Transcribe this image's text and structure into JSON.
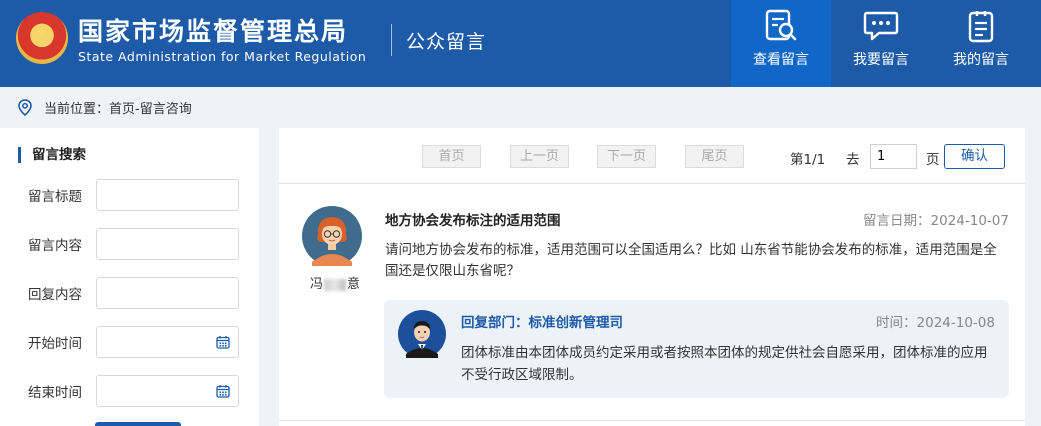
{
  "header": {
    "title_cn": "国家市场监督管理总局",
    "title_en": "State Administration for Market Regulation",
    "subtitle": "公众留言",
    "nav": [
      {
        "label": "查看留言",
        "icon": "search-document-icon",
        "active": true
      },
      {
        "label": "我要留言",
        "icon": "chat-bubble-icon",
        "active": false
      },
      {
        "label": "我的留言",
        "icon": "clipboard-list-icon",
        "active": false
      }
    ]
  },
  "breadcrumb": {
    "label": "当前位置：",
    "path": "首页-留言咨询"
  },
  "search": {
    "title": "留言搜索",
    "fields": [
      {
        "label": "留言标题",
        "value": ""
      },
      {
        "label": "留言内容",
        "value": ""
      },
      {
        "label": "回复内容",
        "value": ""
      },
      {
        "label": "开始时间",
        "value": ""
      },
      {
        "label": "结束时间",
        "value": ""
      }
    ]
  },
  "pager": {
    "first": "首页",
    "prev": "上一页",
    "next": "下一页",
    "last": "尾页",
    "page_info": "第1/1",
    "go_label": "去",
    "page_value": "1",
    "page_unit": "页",
    "confirm": "确认"
  },
  "message": {
    "title": "地方协会发布标注的适用范围",
    "date": "留言日期：2024-10-07",
    "name_prefix": "冯",
    "name_suffix": "意",
    "body": "请问地方协会发布的标准，适用范围可以全国适用么？比如 山东省节能协会发布的标准，适用范围是全国还是仅限山东省呢？",
    "reply": {
      "dept": "回复部门：标准创新管理司",
      "date": "时间：2024-10-08",
      "body": "团体标准由本团体成员约定采用或者按照本团体的规定供社会自愿采用，团体标准的应用不受行政区域限制。"
    }
  },
  "colors": {
    "brand": "#1d5ba8",
    "active_nav": "#1167c8",
    "reply_bg": "#edf2f8"
  }
}
